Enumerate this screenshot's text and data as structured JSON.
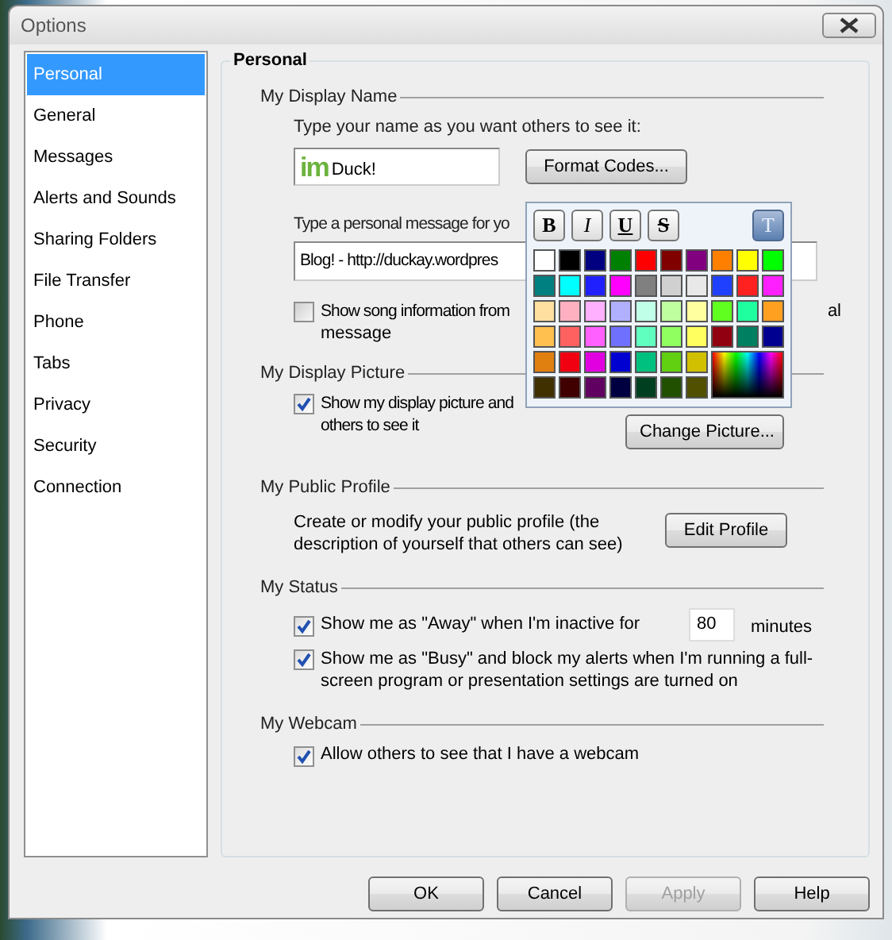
{
  "window": {
    "title": "Options"
  },
  "sidebar": {
    "items": [
      {
        "label": "Personal",
        "selected": true
      },
      {
        "label": "General",
        "selected": false
      },
      {
        "label": "Messages",
        "selected": false
      },
      {
        "label": "Alerts and Sounds",
        "selected": false
      },
      {
        "label": "Sharing Folders",
        "selected": false
      },
      {
        "label": "File Transfer",
        "selected": false
      },
      {
        "label": "Phone",
        "selected": false
      },
      {
        "label": "Tabs",
        "selected": false
      },
      {
        "label": "Privacy",
        "selected": false
      },
      {
        "label": "Security",
        "selected": false
      },
      {
        "label": "Connection",
        "selected": false
      }
    ]
  },
  "panel": {
    "title": "Personal",
    "display_name": {
      "heading": "My Display Name",
      "name_prompt": "Type your name as you want others to see it:",
      "name_logo": "im",
      "name_value": "Duck!",
      "format_button": "Format Codes...",
      "message_prompt": "Type a personal message for yo",
      "message_value": "Blog! - http://duckay.wordpres",
      "song_checkbox": {
        "checked": false,
        "label_parts": [
          "Show song information from",
          "al",
          "message"
        ]
      }
    },
    "display_picture": {
      "heading": "My Display Picture",
      "checkbox": {
        "checked": true,
        "label_lines": [
          "Show my display picture and",
          "others to see it"
        ]
      },
      "button": "Change Picture..."
    },
    "public_profile": {
      "heading": "My Public Profile",
      "text": "Create or modify your public profile (the description of yourself that others can see)",
      "button": "Edit Profile"
    },
    "status": {
      "heading": "My Status",
      "away": {
        "checked": true,
        "label": "Show me as \"Away\" when I'm inactive for",
        "minutes": "80",
        "unit": "minutes"
      },
      "busy": {
        "checked": true,
        "label": "Show me as \"Busy\" and block my alerts when I'm running a full-screen program or presentation settings are turned on"
      }
    },
    "webcam": {
      "heading": "My Webcam",
      "checkbox": {
        "checked": true,
        "label": "Allow others to see that I have a webcam"
      }
    }
  },
  "format_popup": {
    "styles": [
      {
        "label": "B",
        "kind": "bold",
        "selected": false
      },
      {
        "label": "I",
        "kind": "italic",
        "selected": false
      },
      {
        "label": "U",
        "kind": "underline",
        "selected": false
      },
      {
        "label": "S",
        "kind": "strike",
        "selected": false
      },
      {
        "label": "T",
        "kind": "text",
        "selected": true
      }
    ],
    "swatches": [
      {
        "color": "#ffffff"
      },
      {
        "color": "#000000"
      },
      {
        "color": "#000080"
      },
      {
        "color": "#008000"
      },
      {
        "color": "#ff0000"
      },
      {
        "color": "#800000"
      },
      {
        "color": "#800080"
      },
      {
        "color": "#ff8000"
      },
      {
        "color": "#ffff00"
      },
      {
        "color": "#00ff00"
      },
      {
        "color": "#008080"
      },
      {
        "color": "#00ffff"
      },
      {
        "color": "#2020ff"
      },
      {
        "color": "#ff00ff"
      },
      {
        "color": "#808080"
      },
      {
        "color": "#d0d0d0"
      },
      {
        "color": "#e8e8e8"
      },
      {
        "color": "#2040ff"
      },
      {
        "color": "#ff2020"
      },
      {
        "color": "#ff20ff"
      },
      {
        "color": "#ffe0a0"
      },
      {
        "color": "#ffb0c0"
      },
      {
        "color": "#ffb0ff"
      },
      {
        "color": "#b0b0ff"
      },
      {
        "color": "#c0ffe8"
      },
      {
        "color": "#c0ffa0"
      },
      {
        "color": "#ffffa0"
      },
      {
        "color": "#60ff20"
      },
      {
        "color": "#20ffa0"
      },
      {
        "color": "#ffa020"
      },
      {
        "color": "#ffc050"
      },
      {
        "color": "#ff6060"
      },
      {
        "color": "#ff60ff"
      },
      {
        "color": "#7070ff"
      },
      {
        "color": "#60ffc0"
      },
      {
        "color": "#90ff60"
      },
      {
        "color": "#ffff60"
      },
      {
        "color": "#900010"
      },
      {
        "color": "#008060"
      },
      {
        "color": "#000090"
      },
      {
        "color": "#e08010"
      },
      {
        "color": "#f00010"
      },
      {
        "color": "#e000e0"
      },
      {
        "color": "#0000d0"
      },
      {
        "color": "#00c080"
      },
      {
        "color": "#60d010"
      },
      {
        "color": "#d0c000"
      },
      {
        "color": "#403000"
      },
      {
        "color": "#400000"
      },
      {
        "color": "#600060"
      },
      {
        "color": "#000040"
      },
      {
        "color": "#004020"
      },
      {
        "color": "#205000"
      },
      {
        "color": "#505000"
      }
    ]
  },
  "buttons": [
    {
      "label": "OK",
      "disabled": false
    },
    {
      "label": "Cancel",
      "disabled": false
    },
    {
      "label": "Apply",
      "disabled": true
    },
    {
      "label": "Help",
      "disabled": false
    }
  ]
}
